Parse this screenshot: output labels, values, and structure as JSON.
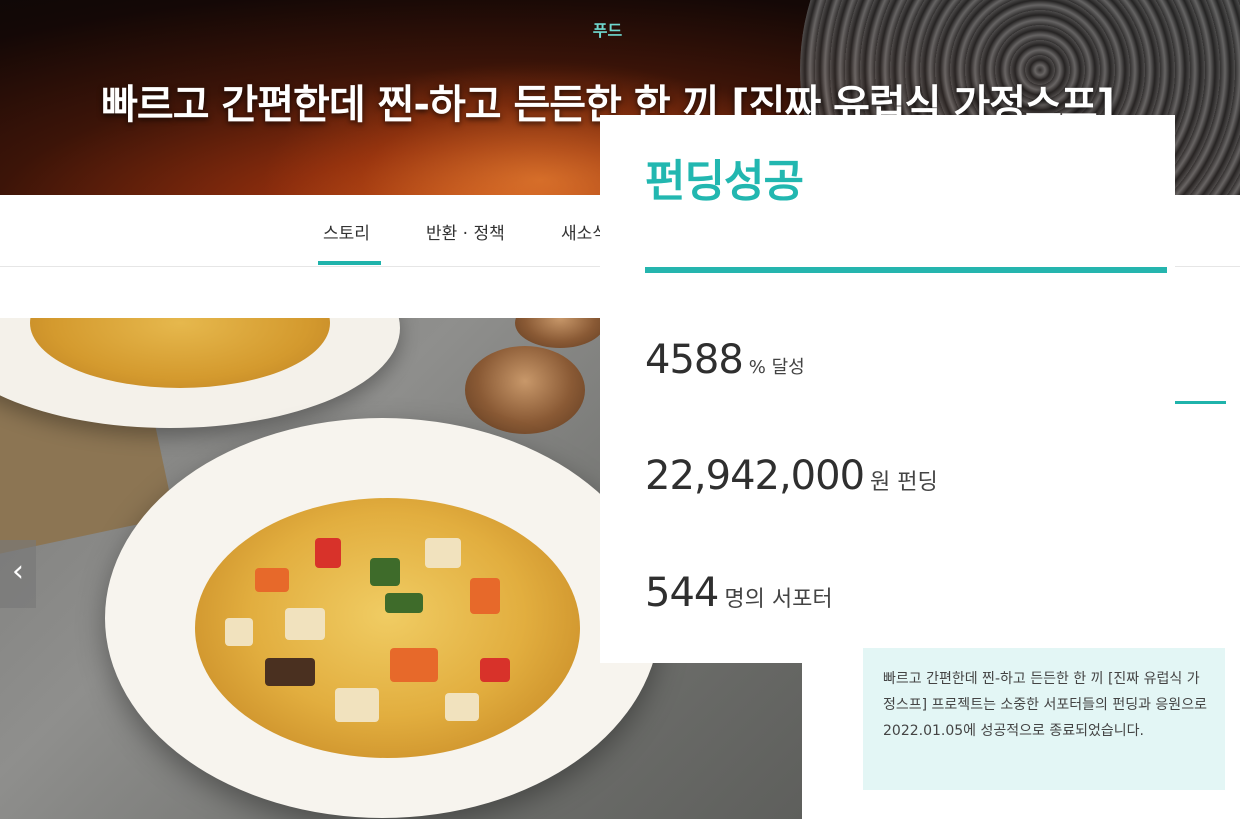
{
  "header": {
    "category": "푸드",
    "title": "빠르고 간편한데 찐-하고 든든한 한 끼 [진짜 유럽식 가정스프]"
  },
  "tabs": [
    {
      "label": "스토리",
      "active": true
    },
    {
      "label": "반환 · 정책",
      "active": false
    },
    {
      "label": "새소식",
      "active": false
    }
  ],
  "gallery": {
    "prev_arrow": "‹"
  },
  "funding": {
    "status": "펀딩성공",
    "rate_value": "4588",
    "rate_unit": "% 달성",
    "amount_value": "22,942,000",
    "amount_unit": "원 펀딩",
    "supporters_value": "544",
    "supporters_unit": "명의 서포터"
  },
  "notice": {
    "text": "빠르고 간편한데 찐-하고 든든한 한 끼 [진짜 유럽식 가정스프] 프로젝트는 소중한 서포터들의 펀딩과 응원으로 2022.01.05에 성공적으로 종료되었습니다."
  },
  "colors": {
    "accent": "#1fb3ab",
    "notice_bg": "#e3f6f5"
  }
}
